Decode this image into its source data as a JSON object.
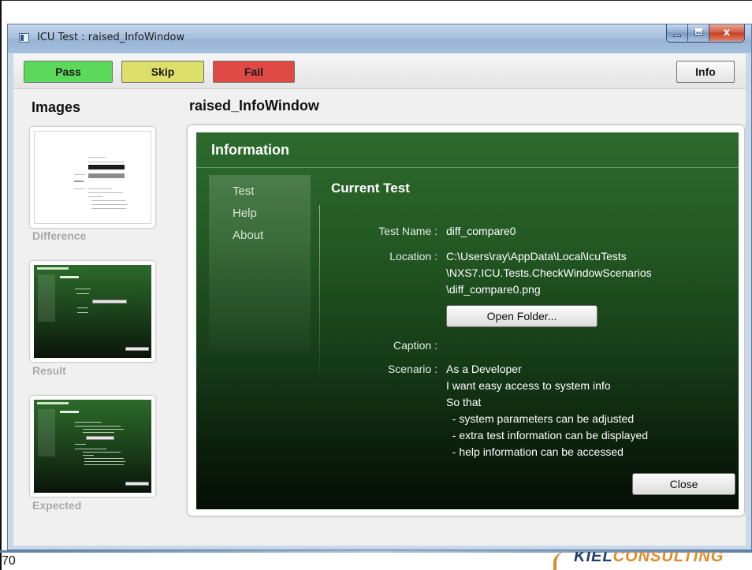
{
  "window": {
    "title": "ICU Test : raised_InfoWindow",
    "minimize": "",
    "maximize": "",
    "close": "x"
  },
  "toolbar": {
    "pass": "Pass",
    "skip": "Skip",
    "fail": "Fail",
    "info": "Info"
  },
  "sidebar": {
    "heading": "Images",
    "thumbnails": [
      {
        "label": "Difference"
      },
      {
        "label": "Result"
      },
      {
        "label": "Expected"
      }
    ]
  },
  "main": {
    "title": "raised_InfoWindow"
  },
  "info_window": {
    "header": "Information",
    "nav": [
      "Test",
      "Help",
      "About"
    ],
    "section_title": "Current Test",
    "fields": {
      "test_name_label": "Test Name :",
      "test_name_value": "diff_compare0",
      "location_label": "Location :",
      "location_lines": [
        "C:\\Users\\ray\\AppData\\Local\\IcuTests",
        "\\NXS7.ICU.Tests.CheckWindowScenarios",
        "\\diff_compare0.png"
      ],
      "open_folder": "Open Folder...",
      "caption_label": "Caption :",
      "scenario_label": "Scenario :",
      "scenario_lines": [
        "As a Developer",
        "I want easy access to system info",
        "So that",
        "  - system parameters can be adjusted",
        "  - extra test information can be displayed",
        "  - help information can be accessed"
      ]
    },
    "close_button": "Close"
  },
  "slide": {
    "number": "70",
    "logo_text_primary": "KIEL",
    "logo_text_accent": "CONSULTING"
  }
}
